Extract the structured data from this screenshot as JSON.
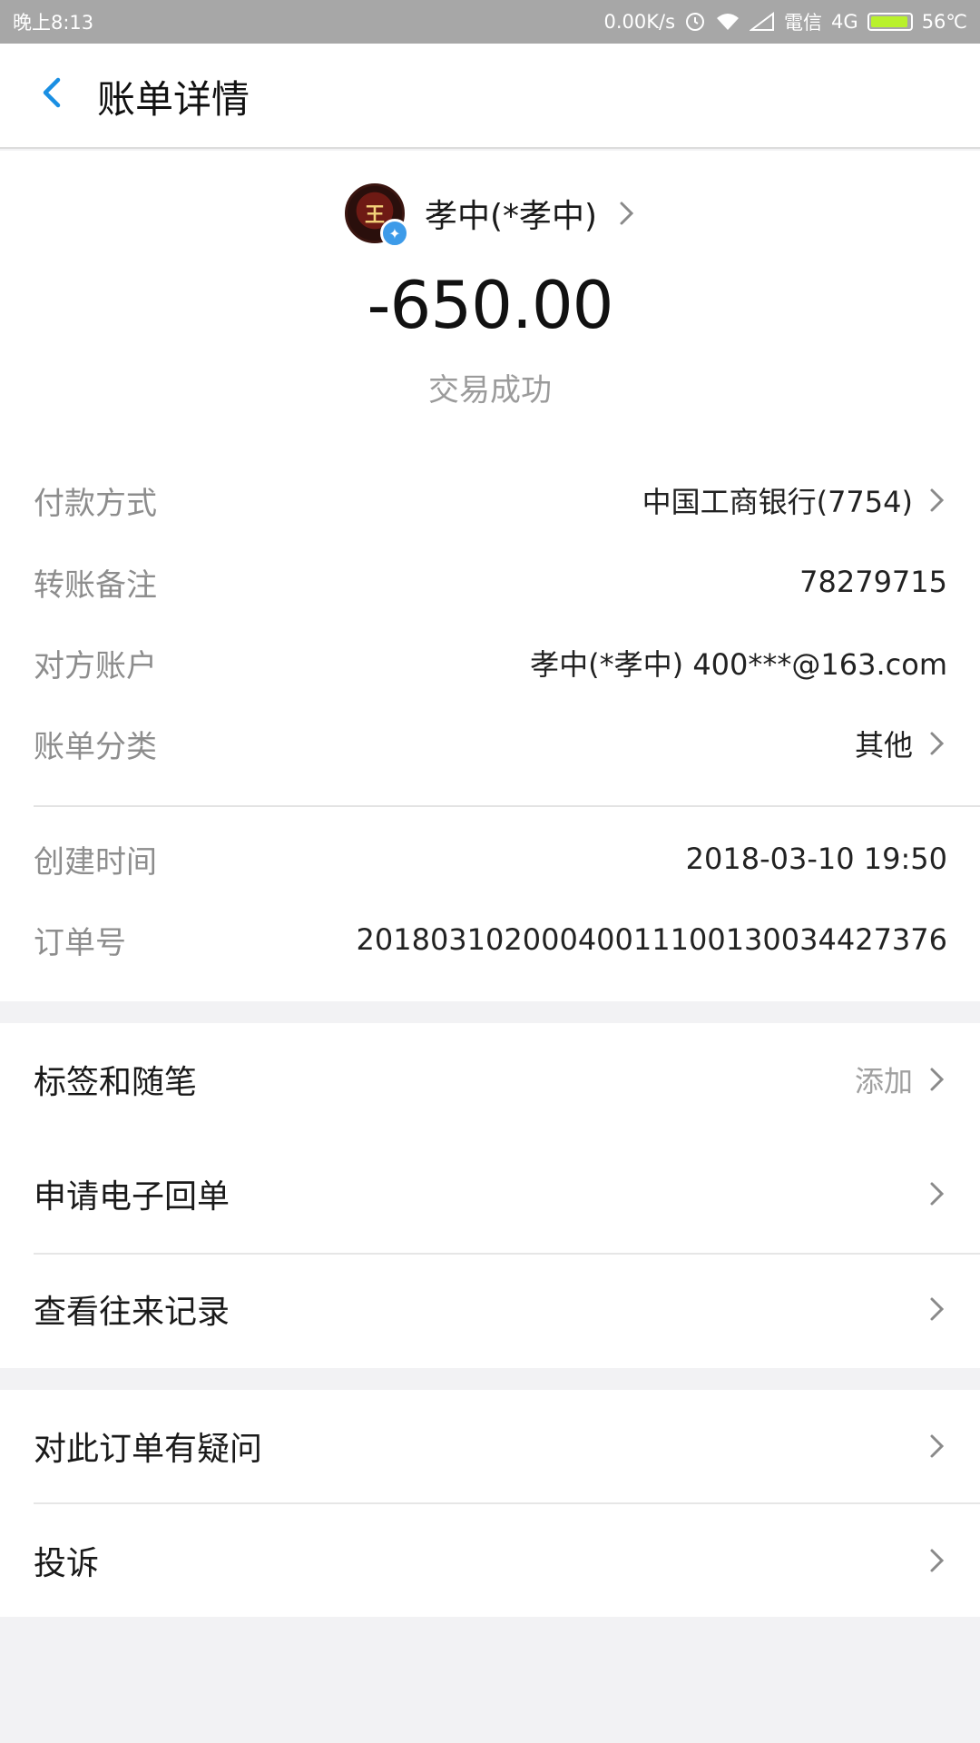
{
  "status_bar": {
    "time": "晚上8:13",
    "net_speed": "0.00K/s",
    "carrier": "電信",
    "network": "4G",
    "battery_percent": 0.95,
    "temperature": "56℃"
  },
  "navbar": {
    "title": "账单详情"
  },
  "payee": {
    "name": "孝中(*孝中)",
    "avatar_glyph": "王"
  },
  "amount": "-650.00",
  "trade_status": "交易成功",
  "details": [
    {
      "label": "付款方式",
      "value": "中国工商银行(7754)"
    },
    {
      "label": "转账备注",
      "value": "78279715"
    },
    {
      "label": "对方账户",
      "value": "孝中(*孝中)  400***@163.com"
    },
    {
      "label": "账单分类",
      "value": "其他"
    },
    {
      "label": "创建时间",
      "value": "2018-03-10  19:50"
    },
    {
      "label": "订单号",
      "value": "20180310200040011100130034427376"
    }
  ],
  "menu": {
    "tags": {
      "label": "标签和随笔",
      "hint": "添加"
    },
    "receipt": {
      "label": "申请电子回单"
    },
    "records": {
      "label": "查看往来记录"
    },
    "question": {
      "label": "对此订单有疑问"
    },
    "complaint": {
      "label": "投诉"
    }
  },
  "colors": {
    "accent": "#1a8fe3",
    "status_bar": "#a7a7a7",
    "battery": "#b9f12c",
    "label_gray": "#8d8d8d"
  }
}
